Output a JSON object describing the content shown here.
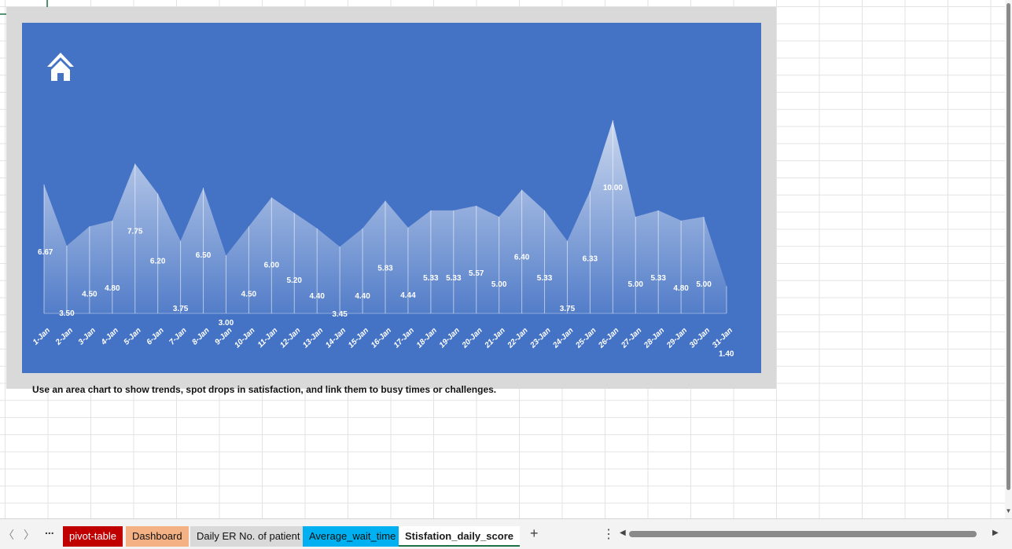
{
  "caption": "Use an area chart to show trends, spot drops in satisfaction, and link them to busy times or challenges.",
  "colors": {
    "chart_bg": "#4472c4",
    "panel_bg": "#d9d9d9",
    "label_color": "#ffffff",
    "tab_pivot": "#c00000",
    "tab_dashboard": "#f4b183",
    "tab_daily": "#d9d9d9",
    "tab_average": "#00b0f0"
  },
  "sheet_tabs": [
    {
      "label": "pivot-table"
    },
    {
      "label": "Dashboard"
    },
    {
      "label": "Daily ER No. of patient"
    },
    {
      "label": "Average_wait_time"
    },
    {
      "label": "Stisfation_daily_score",
      "active": true
    }
  ],
  "tabbar": {
    "ellipsis": "...",
    "add": "+",
    "more": "⋮",
    "scroll_left": "◀",
    "scroll_right": "▶",
    "nav_prev": "〈",
    "nav_next": "〉"
  },
  "chart_data": {
    "type": "area",
    "title": "",
    "xlabel": "",
    "ylabel": "",
    "ylim": [
      0,
      10
    ],
    "grid": false,
    "legend": "none",
    "categories": [
      "1-Jan",
      "2-Jan",
      "3-Jan",
      "4-Jan",
      "5-Jan",
      "6-Jan",
      "7-Jan",
      "8-Jan",
      "9-Jan",
      "10-Jan",
      "11-Jan",
      "12-Jan",
      "13-Jan",
      "14-Jan",
      "15-Jan",
      "16-Jan",
      "17-Jan",
      "18-Jan",
      "19-Jan",
      "20-Jan",
      "21-Jan",
      "22-Jan",
      "23-Jan",
      "24-Jan",
      "25-Jan",
      "26-Jan",
      "27-Jan",
      "28-Jan",
      "29-Jan",
      "30-Jan",
      "31-Jan"
    ],
    "values": [
      6.67,
      3.5,
      4.5,
      4.8,
      7.75,
      6.2,
      3.75,
      6.5,
      3.0,
      4.5,
      6.0,
      5.2,
      4.4,
      3.45,
      4.4,
      5.83,
      4.44,
      5.33,
      5.33,
      5.57,
      5.0,
      6.4,
      5.33,
      3.75,
      6.33,
      10.0,
      5.0,
      5.33,
      4.8,
      5.0,
      1.4
    ],
    "data_labels": [
      "6.67",
      "3.50",
      "4.50",
      "4.80",
      "7.75",
      "6.20",
      "3.75",
      "6.50",
      "3.00",
      "4.50",
      "6.00",
      "5.20",
      "4.40",
      "3.45",
      "4.40",
      "5.83",
      "4.44",
      "5.33",
      "5.33",
      "5.57",
      "5.00",
      "6.40",
      "5.33",
      "3.75",
      "6.33",
      "10.00",
      "5.00",
      "5.33",
      "4.80",
      "5.00",
      "1.40"
    ]
  }
}
